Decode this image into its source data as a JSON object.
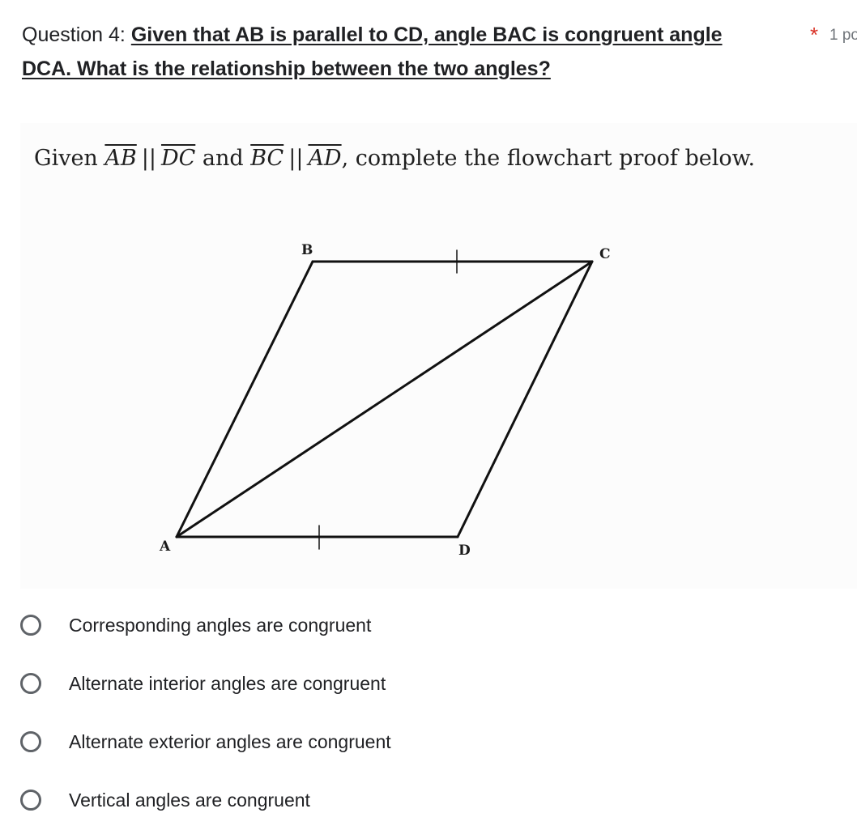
{
  "question": {
    "number_label": "Question 4: ",
    "prompt_line1": "Given that AB is parallel to CD, angle BAC is congruent angle",
    "prompt_line2": "DCA. What is the relationship between the two angles?",
    "required_marker": "*",
    "points_label": "1 po"
  },
  "figure": {
    "given": {
      "prefix": "Given ",
      "seg1": "AB",
      "parallel_symbol": "||",
      "seg2": "DC",
      "conj": " and ",
      "seg3": "BC",
      "seg4": "AD",
      "suffix": ", complete the flowchart proof below."
    },
    "vertex_labels": {
      "A": "A",
      "B": "B",
      "C": "C",
      "D": "D"
    }
  },
  "options": [
    {
      "label": "Corresponding angles are congruent",
      "selected": false
    },
    {
      "label": "Alternate interior angles are congruent",
      "selected": false
    },
    {
      "label": "Alternate exterior angles are congruent",
      "selected": false
    },
    {
      "label": "Vertical angles are congruent",
      "selected": false
    }
  ]
}
